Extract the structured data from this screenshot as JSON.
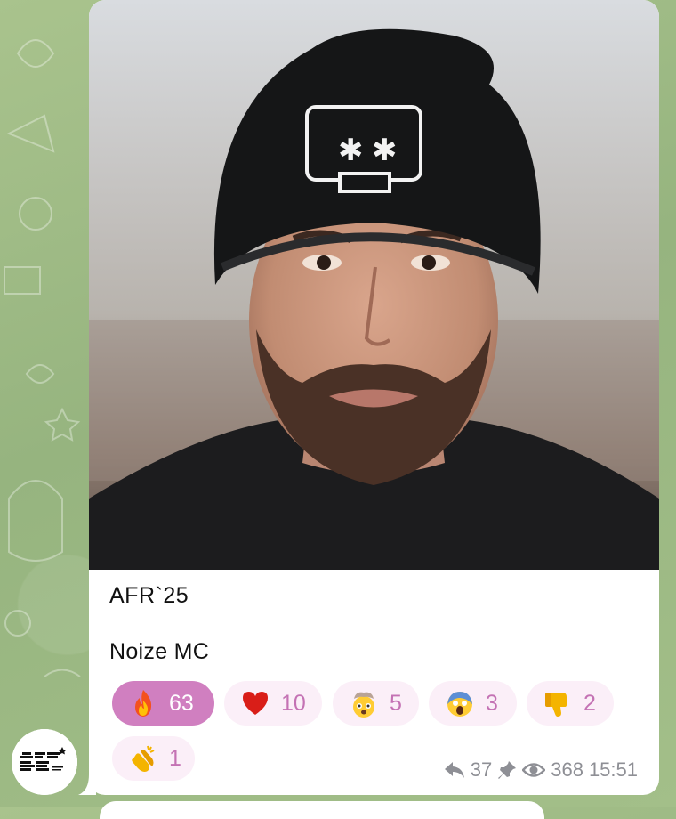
{
  "post": {
    "title": "AFR`25",
    "subtitle": "Noize MC",
    "photo_alt": "Noize MC"
  },
  "reactions": [
    {
      "emoji_icon": "fire-icon",
      "count": "63",
      "active": true
    },
    {
      "emoji_icon": "red-heart-icon",
      "count": "10",
      "active": false
    },
    {
      "emoji_icon": "exploding-head-icon",
      "count": "5",
      "active": false
    },
    {
      "emoji_icon": "screaming-face-icon",
      "count": "3",
      "active": false
    },
    {
      "emoji_icon": "thumbs-down-icon",
      "count": "2",
      "active": false
    },
    {
      "emoji_icon": "clapping-hands-icon",
      "count": "1",
      "active": false
    }
  ],
  "meta": {
    "forwards": "37",
    "views": "368",
    "time": "15:51"
  },
  "channel": {
    "avatar_text": "AFR 25",
    "avatar_small_text": "POWERED BY"
  },
  "colors": {
    "accent": "#d07fc0",
    "reaction_bg": "#fbeff8",
    "reaction_text": "#c472b4",
    "meta_text": "#8e8f95",
    "wallpaper": "#9fba86"
  }
}
